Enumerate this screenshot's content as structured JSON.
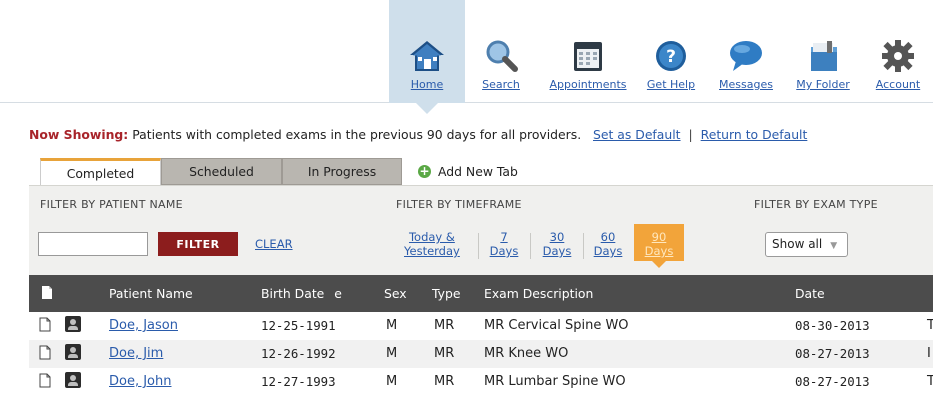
{
  "nav": {
    "items": [
      {
        "label": "Home",
        "icon": "home-icon",
        "active": true
      },
      {
        "label": "Search",
        "icon": "search-icon"
      },
      {
        "label": "Appointments",
        "icon": "calendar-icon"
      },
      {
        "label": "Get Help",
        "icon": "help-icon"
      },
      {
        "label": "Messages",
        "icon": "messages-icon"
      },
      {
        "label": "My Folder",
        "icon": "folder-icon"
      },
      {
        "label": "Account",
        "icon": "gear-icon"
      }
    ]
  },
  "now_showing": {
    "label": "Now Showing:",
    "text": "Patients with completed exams in the previous 90 days for all providers.",
    "set_default": "Set as Default",
    "separator": "|",
    "return_default": "Return to Default"
  },
  "tabs": {
    "items": [
      "Completed",
      "Scheduled",
      "In Progress"
    ],
    "add_new": "Add New Tab"
  },
  "filters": {
    "by_name": {
      "heading": "FILTER BY PATIENT NAME",
      "input_value": "",
      "button": "FILTER",
      "clear": "CLEAR"
    },
    "by_timeframe": {
      "heading": "FILTER BY TIMEFRAME",
      "options": [
        {
          "line1": "Today &",
          "line2": "Yesterday"
        },
        {
          "line1": "7",
          "line2": "Days"
        },
        {
          "line1": "30",
          "line2": "Days"
        },
        {
          "line1": "60",
          "line2": "Days"
        },
        {
          "line1": "90",
          "line2": "Days",
          "active": true
        }
      ]
    },
    "by_exam_type": {
      "heading": "FILTER BY EXAM TYPE",
      "selected": "Show all"
    }
  },
  "table": {
    "headers": {
      "patient_name": "Patient Name",
      "birth_date": "Birth Date",
      "birth_date_suffix": "e",
      "sex": "Sex",
      "type": "Type",
      "exam_description": "Exam Description",
      "date": "Date"
    },
    "rows": [
      {
        "name": "Doe, Jason",
        "birth_date": "12-25-1991",
        "sex": "M",
        "type": "MR",
        "exam": "MR Cervical Spine WO",
        "date": "08-30-2013",
        "extra": "T"
      },
      {
        "name": "Doe, Jim",
        "birth_date": "12-26-1992",
        "sex": "M",
        "type": "MR",
        "exam": "MR Knee WO",
        "date": "08-27-2013",
        "extra": "I"
      },
      {
        "name": "Doe, John",
        "birth_date": "12-27-1993",
        "sex": "M",
        "type": "MR",
        "exam": "MR Lumbar Spine WO",
        "date": "08-27-2013",
        "extra": "T"
      }
    ]
  },
  "colors": {
    "accent_orange": "#f2a43a",
    "link_blue": "#2a5bab",
    "filter_button": "#8c1d1d",
    "now_showing_red": "#a8242a",
    "header_dark": "#4c4c4c"
  }
}
